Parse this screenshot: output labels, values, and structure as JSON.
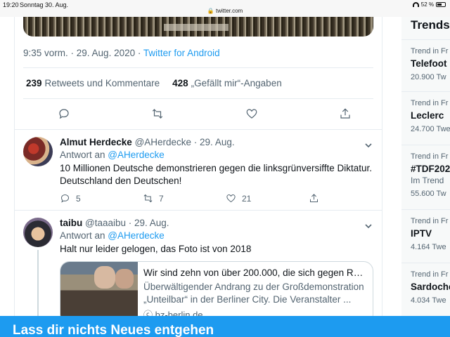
{
  "status_bar": {
    "time": "19:20",
    "date": "Sonntag 30. Aug.",
    "url": "twitter.com",
    "battery": "52 %"
  },
  "tweet": {
    "timestamp": "9:35 vorm. · 29. Aug. 2020",
    "separator": " · ",
    "source": "Twitter for Android",
    "retweets_count": "239",
    "retweets_label": "Retweets und Kommentare",
    "likes_count": "428",
    "likes_label": "„Gefällt mir“-Angaben"
  },
  "replies": [
    {
      "name": "Almut Herdecke",
      "handle": "@AHerdecke · 29. Aug.",
      "reply_to_prefix": "Antwort an ",
      "reply_to": "@AHerdecke",
      "text": "10 Millionen Deutsche demonstrieren gegen die linksgrünversiffte Diktatur. Deutschland den Deutschen!",
      "reply_count": "5",
      "retweet_count": "7",
      "like_count": "21"
    },
    {
      "name": "taibu",
      "handle": "@taaaibu · 29. Aug.",
      "reply_to_prefix": "Antwort an ",
      "reply_to": "@AHerdecke",
      "text": "Halt nur leider gelogen, das Foto ist von 2018",
      "card": {
        "title": "Wir sind zehn von über 200.000, die sich gegen Ra...",
        "description": "Überwältigender Andrang zu der Großdemonstration „Unteilbar“ in der Berliner City. Die Veranstalter ...",
        "link": "ⓒ bz-berlin.de"
      }
    }
  ],
  "sidebar": {
    "title": "Trends",
    "trends": [
      {
        "context": "Trend in Fr",
        "name": "Telefoot",
        "extra": "",
        "count": "20.900 Tw"
      },
      {
        "context": "Trend in Fr",
        "name": "Leclerc",
        "extra": "",
        "count": "24.700 Twe"
      },
      {
        "context": "Trend in Fr",
        "name": "#TDF202",
        "extra": "Im Trend",
        "count": "55.600 Tw"
      },
      {
        "context": "Trend in Fr",
        "name": "IPTV",
        "extra": "",
        "count": "4.164 Twe"
      },
      {
        "context": "Trend in Fr",
        "name": "Sardoche",
        "extra": "",
        "count": "4.034 Twe"
      }
    ]
  },
  "banner": {
    "text": "Lass dir nichts Neues entgehen"
  },
  "colors": {
    "accent": "#1d9bf0",
    "text_secondary": "#536471",
    "border": "#e6ecf0"
  }
}
